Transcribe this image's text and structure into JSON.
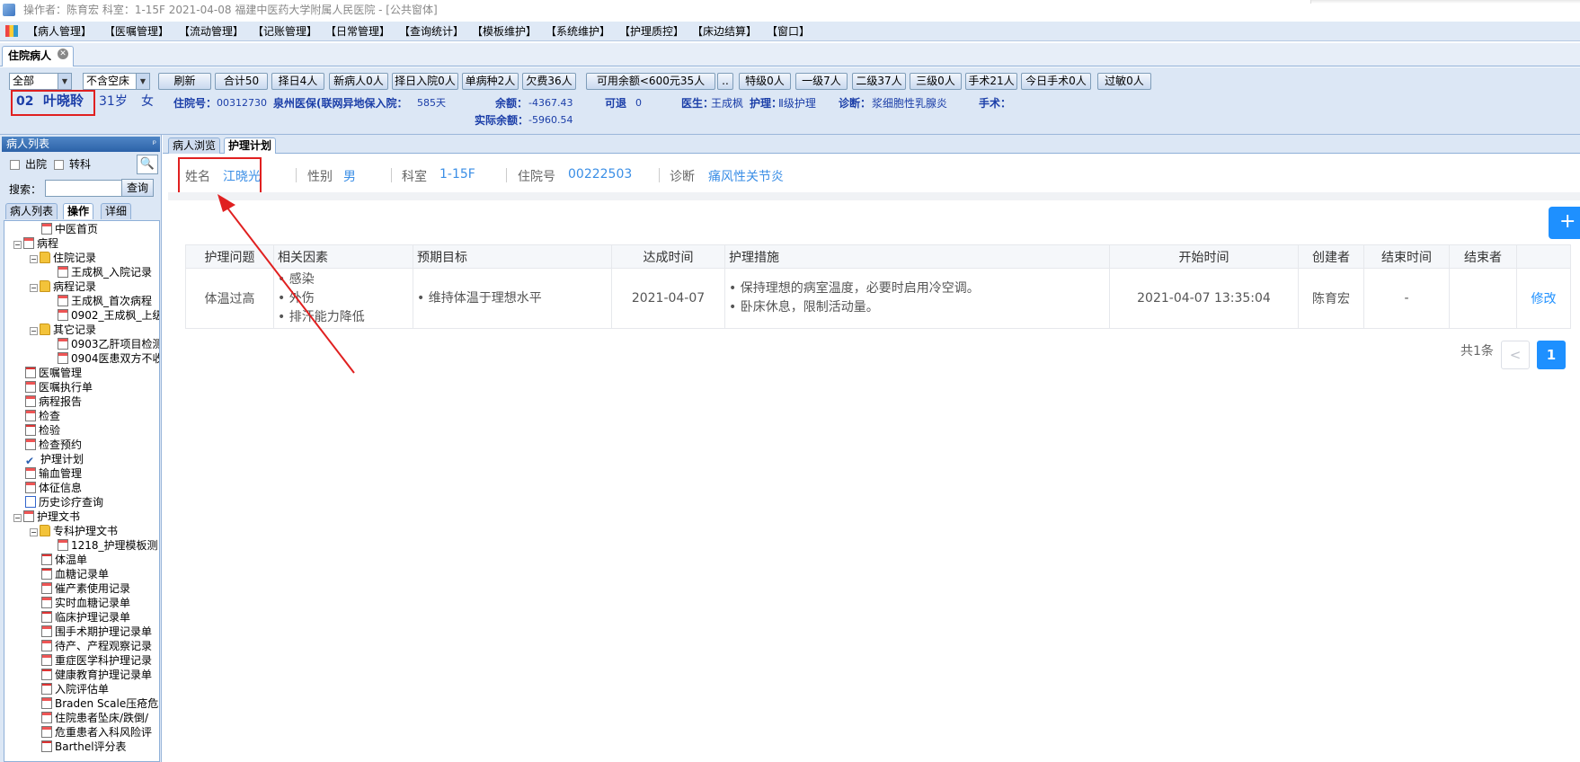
{
  "titlebar": {
    "text": "操作者：陈育宏  科室：1-15F  2021-04-08   福建中医药大学附属人民医院 - [公共窗体]"
  },
  "menu": [
    "【病人管理】",
    "【医嘱管理】",
    "【流动管理】",
    "【记账管理】",
    "【日常管理】",
    "【查询统计】",
    "【模板维护】",
    "【系统维护】",
    "【护理质控】",
    "【床边结算】",
    "【窗口】"
  ],
  "window_tab": {
    "label": "住院病人"
  },
  "toolbar": {
    "filter1": "全部",
    "filter2": "不含空床",
    "buttons": [
      "刷新",
      "合计50",
      "择日4人",
      "新病人0人",
      "择日入院0人",
      "单病种2人",
      "欠费36人",
      "可用余额<600元35人",
      "..",
      "特级0人",
      "一级7人",
      "二级37人",
      "三级0人",
      "手术21人",
      "今日手术0人",
      "过敏0人"
    ]
  },
  "patient_bar": {
    "bed": "02",
    "name": "叶晓聆",
    "age": "31岁",
    "sex": "女",
    "admission_no_label": "住院号：",
    "admission_no": "00312730",
    "insurance": "泉州医保(联网异地保入院：",
    "days": "585天",
    "balance_label": "余额：",
    "balance": "-4367.43",
    "real_balance_label": "实际余额：",
    "real_balance": "-5960.54",
    "refundable_label": "可退",
    "refundable": "0",
    "doctor_label": "医生：",
    "doctor": "王成枫",
    "care_label": "护理：",
    "care": "Ⅱ级护理",
    "diagnosis_label": "诊断：",
    "diagnosis": "浆细胞性乳腺炎",
    "surgery_label": "手术："
  },
  "sidebar": {
    "header": "病人列表",
    "pin": "ᵖ",
    "check_discharged": "出院",
    "check_transfer": "转科",
    "search_label": "搜索：",
    "search_value": "",
    "query_button": "查询",
    "tabs": [
      "病人列表",
      "操作",
      "详细"
    ],
    "tree": [
      {
        "label": "中医首页",
        "level": 1,
        "icon": "doc"
      },
      {
        "label": "病程",
        "level": 0,
        "icon": "doc",
        "exp": "-"
      },
      {
        "label": "住院记录",
        "level": 1,
        "icon": "folder",
        "exp": "-"
      },
      {
        "label": "王成枫_入院记录",
        "level": 2,
        "icon": "doc"
      },
      {
        "label": "病程记录",
        "level": 1,
        "icon": "folder",
        "exp": "-"
      },
      {
        "label": "王成枫_首次病程",
        "level": 2,
        "icon": "doc"
      },
      {
        "label": "0902_王成枫_上级",
        "level": 2,
        "icon": "doc"
      },
      {
        "label": "其它记录",
        "level": 1,
        "icon": "folder",
        "exp": "-"
      },
      {
        "label": "0903乙肝项目检测",
        "level": 2,
        "icon": "doc"
      },
      {
        "label": "0904医患双方不收",
        "level": 2,
        "icon": "doc"
      },
      {
        "label": "医嘱管理",
        "level": 0,
        "icon": "sheet"
      },
      {
        "label": "医嘱执行单",
        "level": 0,
        "icon": "doc"
      },
      {
        "label": "病程报告",
        "level": 0,
        "icon": "doc"
      },
      {
        "label": "检查",
        "level": 0,
        "icon": "doc"
      },
      {
        "label": "检验",
        "level": 0,
        "icon": "sheet"
      },
      {
        "label": "检查预约",
        "level": 0,
        "icon": "doc"
      },
      {
        "label": "护理计划",
        "level": 0,
        "icon": "tick"
      },
      {
        "label": "输血管理",
        "level": 0,
        "icon": "doc"
      },
      {
        "label": "体征信息",
        "level": 0,
        "icon": "doc"
      },
      {
        "label": "历史诊疗查询",
        "level": 0,
        "icon": "pl"
      },
      {
        "label": "护理文书",
        "level": 0,
        "icon": "doc",
        "exp": "-"
      },
      {
        "label": "专科护理文书",
        "level": 1,
        "icon": "folder",
        "exp": "-"
      },
      {
        "label": "1218_护理模板测",
        "level": 2,
        "icon": "doc"
      },
      {
        "label": "体温单",
        "level": 1,
        "icon": "sheet"
      },
      {
        "label": "血糖记录单",
        "level": 1,
        "icon": "sheet"
      },
      {
        "label": "催产素使用记录",
        "level": 1,
        "icon": "doc"
      },
      {
        "label": "实时血糖记录单",
        "level": 1,
        "icon": "doc"
      },
      {
        "label": "临床护理记录单",
        "level": 1,
        "icon": "sheet"
      },
      {
        "label": "围手术期护理记录单",
        "level": 1,
        "icon": "doc"
      },
      {
        "label": "待产、产程观察记录",
        "level": 1,
        "icon": "doc"
      },
      {
        "label": "重症医学科护理记录",
        "level": 1,
        "icon": "doc"
      },
      {
        "label": "健康教育护理记录单",
        "level": 1,
        "icon": "sheet"
      },
      {
        "label": "入院评估单",
        "level": 1,
        "icon": "sheet"
      },
      {
        "label": "Braden Scale压疮危",
        "level": 1,
        "icon": "doc"
      },
      {
        "label": "住院患者坠床/跌倒/",
        "level": 1,
        "icon": "doc"
      },
      {
        "label": "危重患者入科风险评",
        "level": 1,
        "icon": "doc"
      },
      {
        "label": "Barthel评分表",
        "level": 1,
        "icon": "sheet"
      }
    ]
  },
  "main": {
    "tabs": [
      "病人浏览",
      "护理计划"
    ],
    "info": {
      "name_label": "姓名",
      "name": "江晓光",
      "sex_label": "性别",
      "sex": "男",
      "dept_label": "科室",
      "dept": "1-15F",
      "admission_label": "住院号",
      "admission": "00222503",
      "diagnosis_label": "诊断",
      "diagnosis": "痛风性关节炎"
    },
    "add_button": "+",
    "table": {
      "headers": [
        "护理问题",
        "相关因素",
        "预期目标",
        "达成时间",
        "护理措施",
        "开始时间",
        "创建者",
        "结束时间",
        "结束者",
        ""
      ],
      "rows": [
        {
          "problem": "体温过高",
          "factors": [
            "感染",
            "外伤",
            "排汗能力降低"
          ],
          "goal": "维持体温于理想水平",
          "achieve_time": "2021-04-07",
          "measures": [
            "保持理想的病室温度，必要时启用冷空调。",
            "卧床休息，限制活动量。"
          ],
          "start_time": "2021-04-07 13:35:04",
          "creator": "陈育宏",
          "end_time": "-",
          "ender": "",
          "action": "修改"
        }
      ]
    },
    "pager": {
      "total": "共1条",
      "prev": "<",
      "current": "1"
    }
  },
  "colors": {
    "accent": "#1e90ff",
    "annotation": "#e02020",
    "link": "#3a8ee6"
  }
}
